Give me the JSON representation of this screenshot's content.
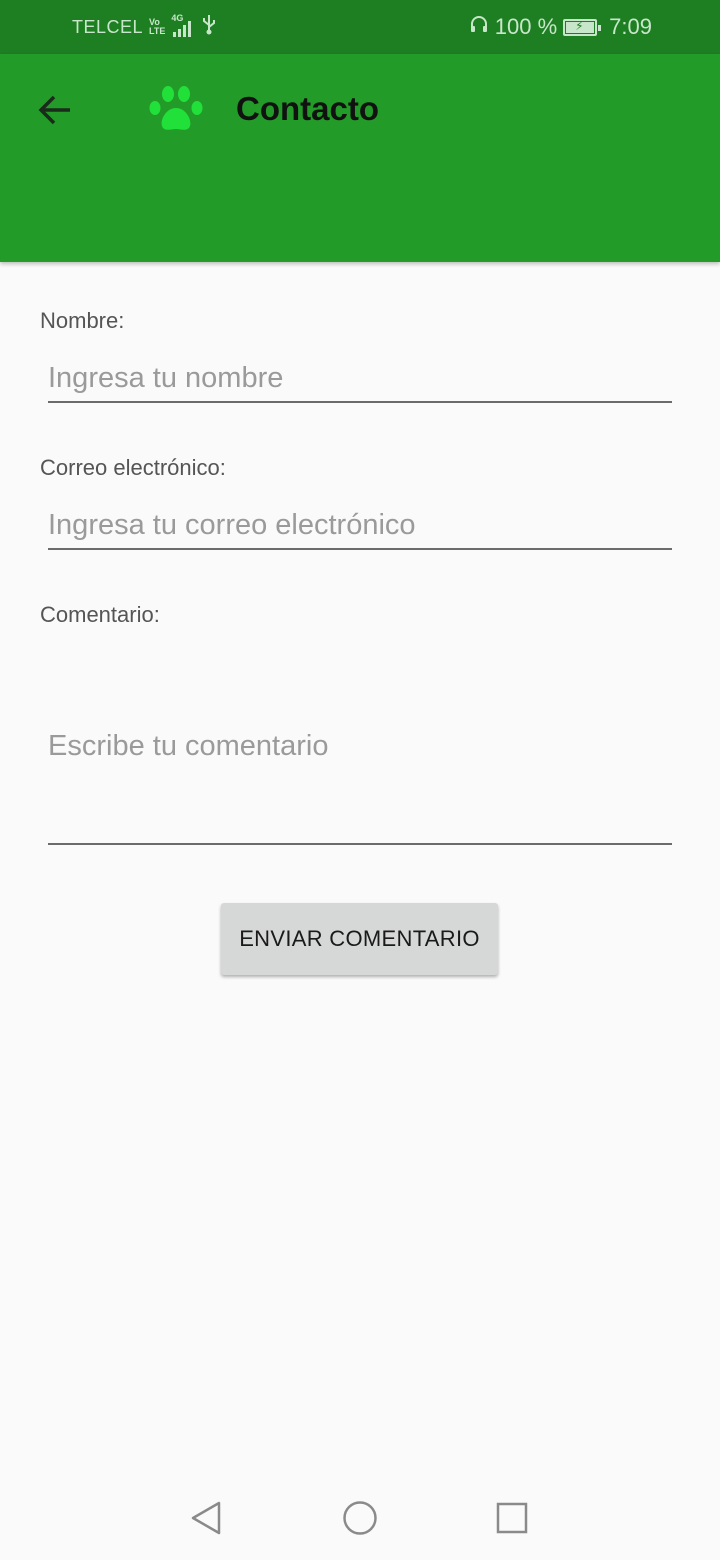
{
  "status_bar": {
    "carrier": "TELCEL",
    "volte_top": "Vo",
    "volte_bottom": "LTE",
    "network": "4G",
    "battery_percent": "100 %",
    "time": "7:09"
  },
  "app_bar": {
    "title": "Contacto",
    "color": "#239b28",
    "logo_color": "#22e03a"
  },
  "form": {
    "name_label": "Nombre:",
    "name_placeholder": "Ingresa tu nombre",
    "name_value": "",
    "email_label": "Correo electrónico:",
    "email_placeholder": "Ingresa tu correo electrónico",
    "email_value": "",
    "comment_label": "Comentario:",
    "comment_placeholder": "Escribe tu comentario",
    "comment_value": "",
    "submit_label": "ENVIAR COMENTARIO"
  },
  "icons": {
    "back": "arrow-left-icon",
    "logo": "paw-icon",
    "nav_back": "triangle-back-icon",
    "nav_home": "circle-home-icon",
    "nav_recents": "square-recents-icon"
  }
}
